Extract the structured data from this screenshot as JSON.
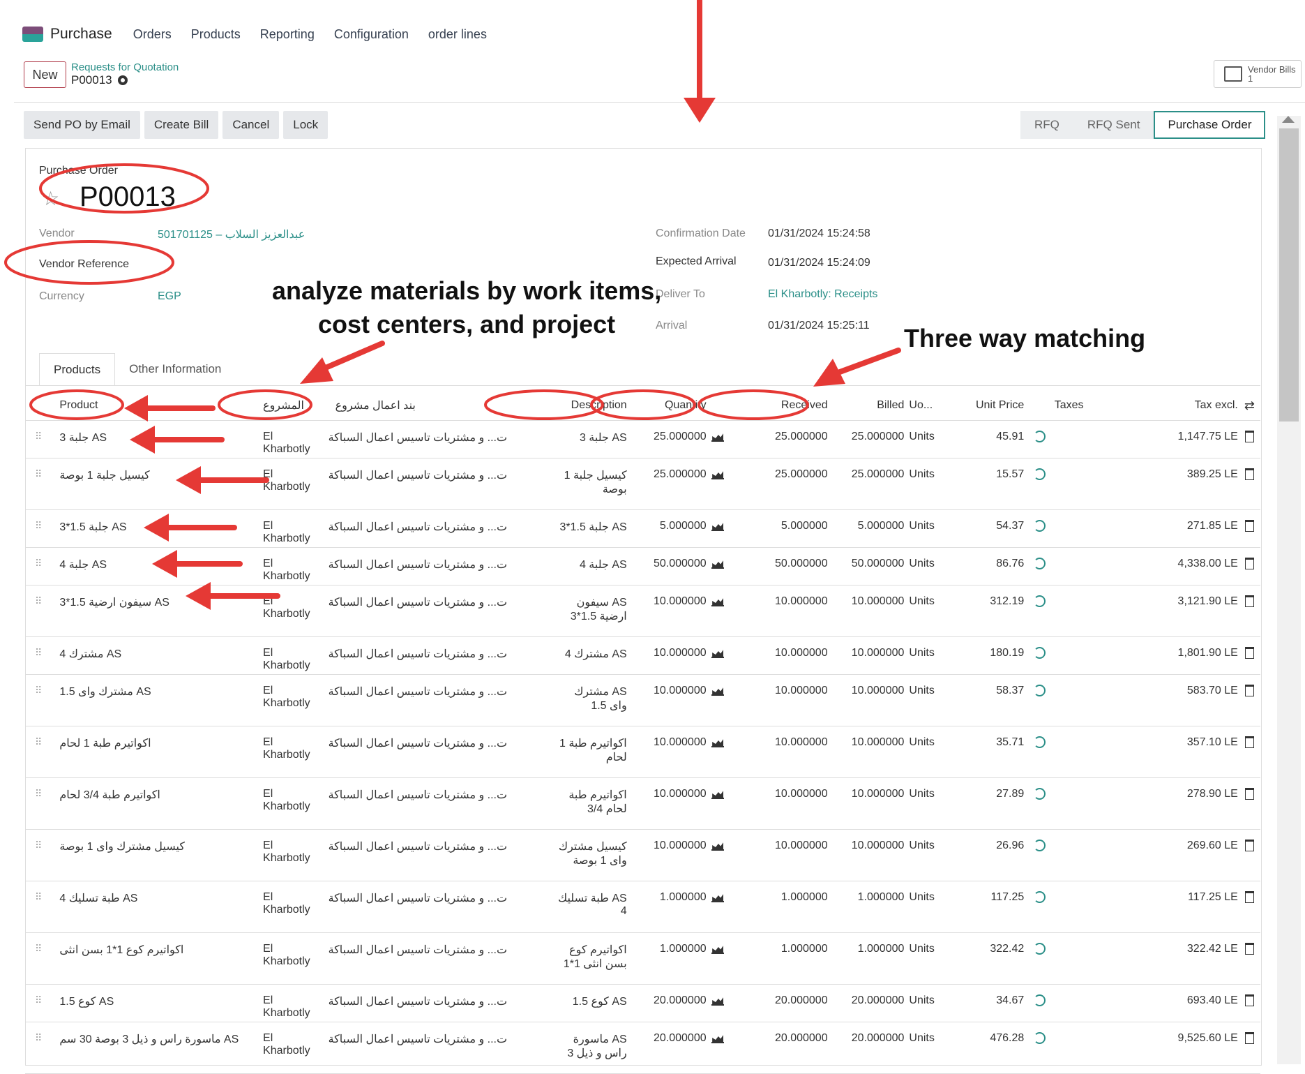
{
  "nav": {
    "app": "Purchase",
    "items": [
      "Orders",
      "Products",
      "Reporting",
      "Configuration",
      "order lines"
    ]
  },
  "control": {
    "new_label": "New",
    "breadcrumb": "Requests for Quotation",
    "record": "P00013",
    "vendor_bills_label": "Vendor Bills",
    "vendor_bills_count": "1"
  },
  "actions": [
    "Send PO by Email",
    "Create Bill",
    "Cancel",
    "Lock"
  ],
  "statusbar": {
    "stages": [
      "RFQ",
      "RFQ Sent",
      "Purchase Order"
    ],
    "active": "Purchase Order"
  },
  "form": {
    "title_label": "Purchase Order",
    "title": "P00013",
    "vendor_label": "Vendor",
    "vendor": "501701125 – عبدالعزيز السلاب",
    "vendor_ref_label": "Vendor Reference",
    "currency_label": "Currency",
    "currency": "EGP",
    "confirmation_label": "Confirmation Date",
    "confirmation": "01/31/2024 15:24:58",
    "expected_label": "Expected Arrival",
    "expected": "01/31/2024 15:24:09",
    "deliver_label": "Deliver To",
    "deliver": "El Kharbotly: Receipts",
    "arrival_label": "Arrival",
    "arrival": "01/31/2024 15:25:11"
  },
  "tabs": [
    "Products",
    "Other Information"
  ],
  "table": {
    "headers": {
      "product": "Product",
      "project": "المشروع",
      "work_item": "بند اعمال مشروع",
      "description": "Description",
      "quantity": "Quantity",
      "received": "Received",
      "billed": "Billed",
      "uom": "Uo...",
      "price": "Unit Price",
      "taxes": "Taxes",
      "subtotal": "Tax excl."
    },
    "rows": [
      {
        "product": "جلبة 3 AS",
        "project": "El Kharbotly",
        "work": "ت... و مشتريات تاسيس اعمال السباكة",
        "desc": "جلبة 3 AS",
        "desc2": "",
        "qty": "25.000000",
        "rec": "25.000000",
        "bill": "25.000000",
        "uom": "Units",
        "price": "45.91",
        "sub": "1,147.75 LE"
      },
      {
        "product": "كيسيل جلبة 1 بوصة",
        "project": "El Kharbotly",
        "work": "ت... و مشتريات تاسيس اعمال السباكة",
        "desc": "كيسيل جلبة 1",
        "desc2": "بوصة",
        "qty": "25.000000",
        "rec": "25.000000",
        "bill": "25.000000",
        "uom": "Units",
        "price": "15.57",
        "sub": "389.25 LE"
      },
      {
        "product": "جلبة 1.5*3 AS",
        "project": "El Kharbotly",
        "work": "ت... و مشتريات تاسيس اعمال السباكة",
        "desc": "جلبة 1.5*3 AS",
        "desc2": "",
        "qty": "5.000000",
        "rec": "5.000000",
        "bill": "5.000000",
        "uom": "Units",
        "price": "54.37",
        "sub": "271.85 LE"
      },
      {
        "product": "جلبة 4 AS",
        "project": "El Kharbotly",
        "work": "ت... و مشتريات تاسيس اعمال السباكة",
        "desc": "جلبة 4 AS",
        "desc2": "",
        "qty": "50.000000",
        "rec": "50.000000",
        "bill": "50.000000",
        "uom": "Units",
        "price": "86.76",
        "sub": "4,338.00 LE"
      },
      {
        "product": "سيفون ارضية 1.5*3 AS",
        "project": "El Kharbotly",
        "work": "ت... و مشتريات تاسيس اعمال السباكة",
        "desc": "سيفون AS",
        "desc2": "ارضية 1.5*3",
        "qty": "10.000000",
        "rec": "10.000000",
        "bill": "10.000000",
        "uom": "Units",
        "price": "312.19",
        "sub": "3,121.90 LE"
      },
      {
        "product": "مشترك 4 AS",
        "project": "El Kharbotly",
        "work": "ت... و مشتريات تاسيس اعمال السباكة",
        "desc": "مشترك 4 AS",
        "desc2": "",
        "qty": "10.000000",
        "rec": "10.000000",
        "bill": "10.000000",
        "uom": "Units",
        "price": "180.19",
        "sub": "1,801.90 LE"
      },
      {
        "product": "مشترك واى 1.5 AS",
        "project": "El Kharbotly",
        "work": "ت... و مشتريات تاسيس اعمال السباكة",
        "desc": "مشترك AS",
        "desc2": "واى 1.5",
        "qty": "10.000000",
        "rec": "10.000000",
        "bill": "10.000000",
        "uom": "Units",
        "price": "58.37",
        "sub": "583.70 LE"
      },
      {
        "product": "اكواتيرم طبة 1 لحام",
        "project": "El Kharbotly",
        "work": "ت... و مشتريات تاسيس اعمال السباكة",
        "desc": "اكواتيرم طبة 1",
        "desc2": "لحام",
        "qty": "10.000000",
        "rec": "10.000000",
        "bill": "10.000000",
        "uom": "Units",
        "price": "35.71",
        "sub": "357.10 LE"
      },
      {
        "product": "اكواتيرم طبة 3/4 لحام",
        "project": "El Kharbotly",
        "work": "ت... و مشتريات تاسيس اعمال السباكة",
        "desc": "اكواتيرم طبة",
        "desc2": "3/4 لحام",
        "qty": "10.000000",
        "rec": "10.000000",
        "bill": "10.000000",
        "uom": "Units",
        "price": "27.89",
        "sub": "278.90 LE"
      },
      {
        "product": "كيسيل مشترك واى 1 بوصة",
        "project": "El Kharbotly",
        "work": "ت... و مشتريات تاسيس اعمال السباكة",
        "desc": "كيسيل مشترك",
        "desc2": "واى 1 بوصة",
        "qty": "10.000000",
        "rec": "10.000000",
        "bill": "10.000000",
        "uom": "Units",
        "price": "26.96",
        "sub": "269.60 LE"
      },
      {
        "product": "طبة تسليك 4 AS",
        "project": "El Kharbotly",
        "work": "ت... و مشتريات تاسيس اعمال السباكة",
        "desc": "طبة تسليك AS",
        "desc2": "4",
        "qty": "1.000000",
        "rec": "1.000000",
        "bill": "1.000000",
        "uom": "Units",
        "price": "117.25",
        "sub": "117.25 LE"
      },
      {
        "product": "اكواتيرم كوع 1*1 بسن انثى",
        "project": "El Kharbotly",
        "work": "ت... و مشتريات تاسيس اعمال السباكة",
        "desc": "اكواتيرم كوع",
        "desc2": "1*1 بسن انثى",
        "qty": "1.000000",
        "rec": "1.000000",
        "bill": "1.000000",
        "uom": "Units",
        "price": "322.42",
        "sub": "322.42 LE"
      },
      {
        "product": "كوع 1.5 AS",
        "project": "El Kharbotly",
        "work": "ت... و مشتريات تاسيس اعمال السباكة",
        "desc": "كوع 1.5 AS",
        "desc2": "",
        "qty": "20.000000",
        "rec": "20.000000",
        "bill": "20.000000",
        "uom": "Units",
        "price": "34.67",
        "sub": "693.40 LE"
      },
      {
        "product": "ماسورة راس و ذيل 3 بوصة 30 سم AS",
        "project": "El Kharbotly",
        "work": "ت... و مشتريات تاسيس اعمال السباكة",
        "desc": "ماسورة AS",
        "desc2": "راس و ذيل 3",
        "qty": "20.000000",
        "rec": "20.000000",
        "bill": "20.000000",
        "uom": "Units",
        "price": "476.28",
        "sub": "9,525.60 LE"
      }
    ]
  },
  "annotations": {
    "analyze_1": "analyze materials by work items,",
    "analyze_2": "cost centers, and project",
    "three_way": "Three way matching"
  },
  "colors": {
    "accent": "#2b8f88",
    "annotation": "#e53935"
  }
}
